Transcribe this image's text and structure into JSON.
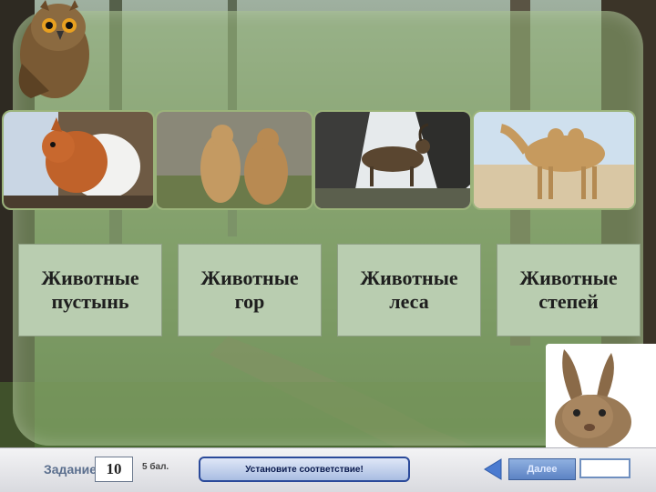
{
  "animal_photos": [
    {
      "id": "squirrel",
      "icon": "squirrel-photo"
    },
    {
      "id": "marmots",
      "icon": "marmots-photo"
    },
    {
      "id": "ibex",
      "icon": "ibex-photo"
    },
    {
      "id": "camel",
      "icon": "camel-photo"
    }
  ],
  "categories": [
    {
      "label": "Животные\nпустынь"
    },
    {
      "label": "Животные\nгор"
    },
    {
      "label": "Животные\nлеса"
    },
    {
      "label": "Животные\nстепей"
    }
  ],
  "footer": {
    "task_label": "Задание",
    "task_number": "10",
    "points": "5 бал.",
    "instruction": "Установите соответствие!",
    "next_label": "Далее"
  },
  "colors": {
    "panel": "#a2b98a",
    "card": "#b9cdb0",
    "button_border": "#2b4a9a"
  }
}
